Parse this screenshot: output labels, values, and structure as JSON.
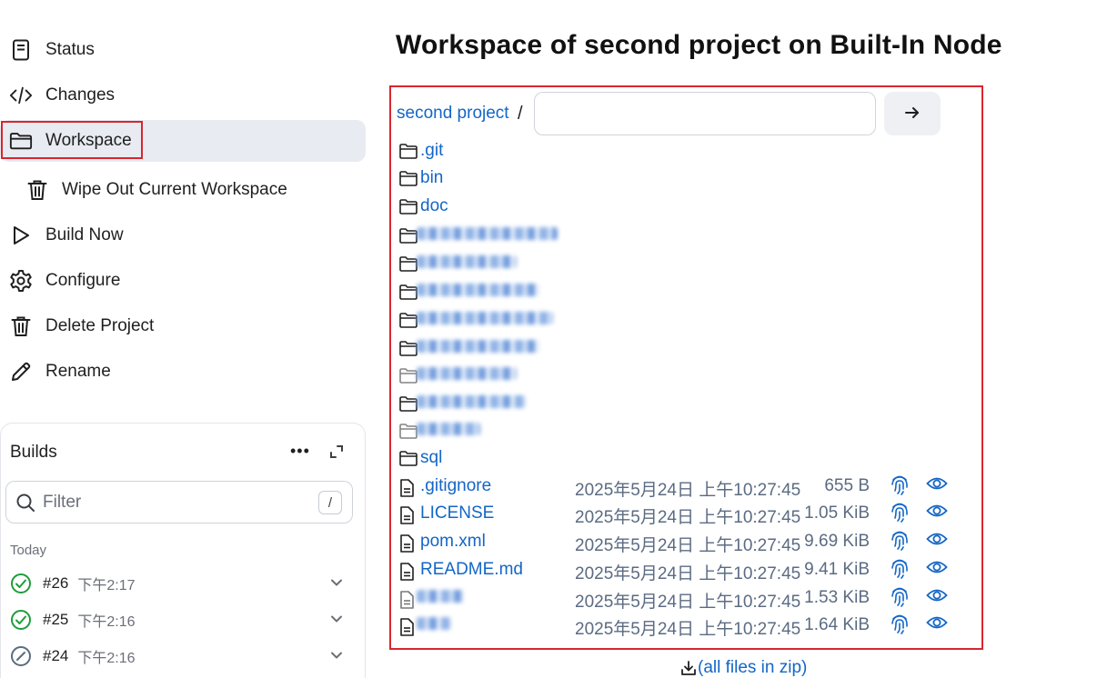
{
  "sidebar": {
    "items": [
      {
        "label": "Status",
        "icon": "document-icon"
      },
      {
        "label": "Changes",
        "icon": "code-icon"
      },
      {
        "label": "Workspace",
        "icon": "folder-icon"
      },
      {
        "label": "Wipe Out Current Workspace",
        "icon": "trash-icon"
      },
      {
        "label": "Build Now",
        "icon": "play-icon"
      },
      {
        "label": "Configure",
        "icon": "gear-icon"
      },
      {
        "label": "Delete Project",
        "icon": "trash-icon"
      },
      {
        "label": "Rename",
        "icon": "pencil-icon"
      }
    ]
  },
  "builds": {
    "title": "Builds",
    "more": "•••",
    "filter_placeholder": "Filter",
    "filter_shortcut": "/",
    "group_label": "Today",
    "items": [
      {
        "number": "#26",
        "time": "下午2:17",
        "status": "success"
      },
      {
        "number": "#25",
        "time": "下午2:16",
        "status": "success"
      },
      {
        "number": "#24",
        "time": "下午2:16",
        "status": "aborted"
      }
    ]
  },
  "main": {
    "title": "Workspace of second project on Built-In Node",
    "breadcrumb": {
      "project": "second project",
      "separator": "/"
    },
    "path_value": "",
    "folders": [
      {
        "name": ".git"
      },
      {
        "name": "bin"
      },
      {
        "name": "doc"
      }
    ],
    "last_folder": {
      "name": "sql"
    },
    "files": [
      {
        "name": ".gitignore",
        "date": "2025年5月24日 上午10:27:45",
        "size": "655 B"
      },
      {
        "name": "LICENSE",
        "date": "2025年5月24日 上午10:27:45",
        "size": "1.05 KiB"
      },
      {
        "name": "pom.xml",
        "date": "2025年5月24日 上午10:27:45",
        "size": "9.69 KiB"
      },
      {
        "name": "README.md",
        "date": "2025年5月24日 上午10:27:45",
        "size": "9.41 KiB"
      },
      {
        "name": "",
        "date": "2025年5月24日 上午10:27:45",
        "size": "1.53 KiB"
      },
      {
        "name": "",
        "date": "2025年5月24日 上午10:27:45",
        "size": "1.64 KiB"
      }
    ],
    "zip_link": "(all files in zip)"
  },
  "colors": {
    "link": "#1466c6",
    "highlight": "#d7262f",
    "success": "#1f9d3a",
    "active_bg": "#e8ebf1"
  }
}
